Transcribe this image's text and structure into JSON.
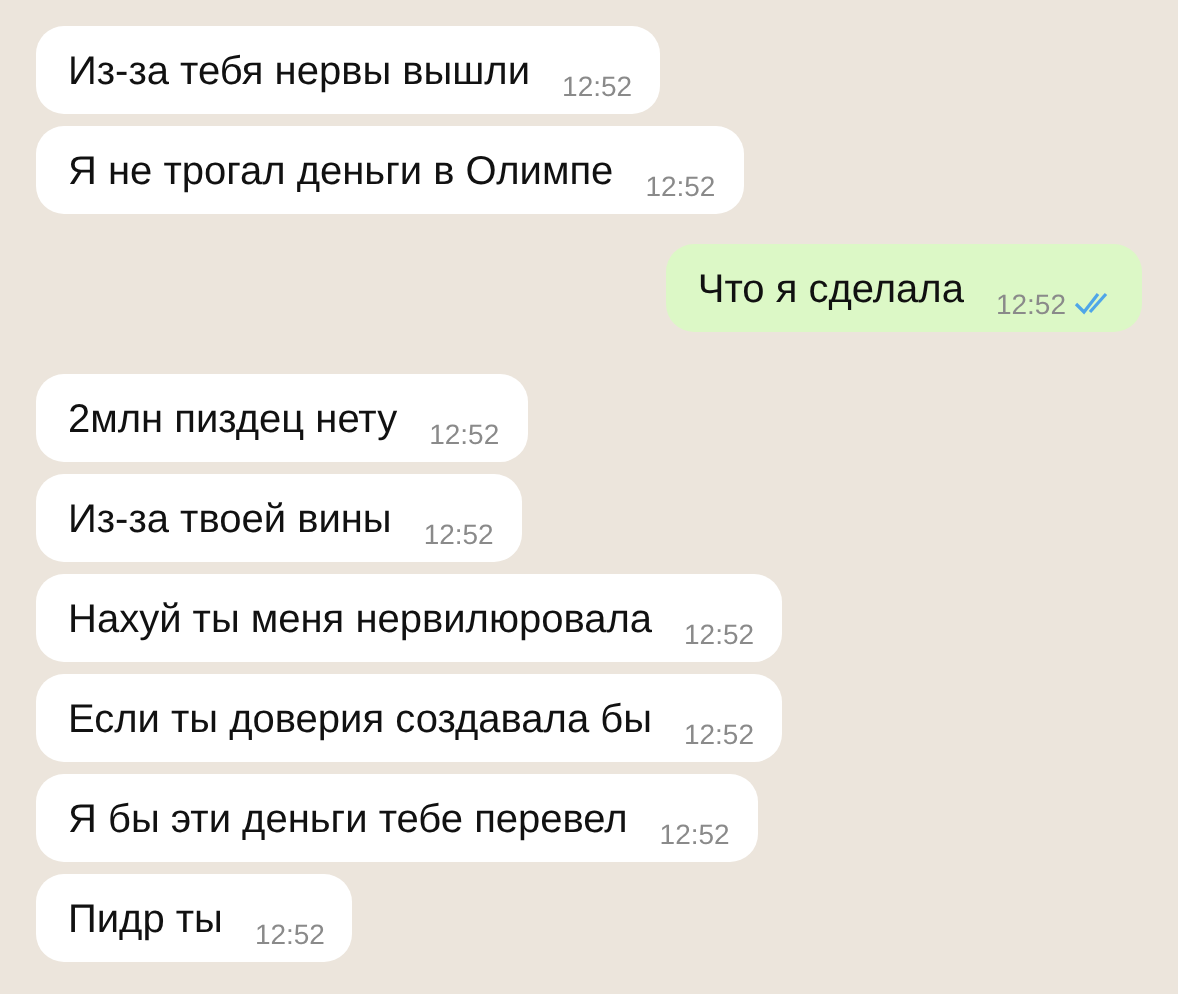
{
  "messages": [
    {
      "kind": "incoming",
      "text": "Из-за тебя нервы вышли",
      "time": "12:52"
    },
    {
      "kind": "incoming",
      "text": "Я не трогал деньги в Олимпе",
      "time": "12:52"
    },
    {
      "kind": "outgoing",
      "text": "Что я сделала",
      "time": "12:52",
      "read": true
    },
    {
      "kind": "incoming",
      "text": "2млн пиздец нету",
      "time": "12:52"
    },
    {
      "kind": "incoming",
      "text": "Из-за твоей вины",
      "time": "12:52"
    },
    {
      "kind": "incoming",
      "text": "Нахуй ты меня нервилюровала",
      "time": "12:52"
    },
    {
      "kind": "incoming",
      "text": "Если ты доверия создавала бы",
      "time": "12:52"
    },
    {
      "kind": "incoming",
      "text": "Я бы эти деньги тебе перевел",
      "time": "12:52"
    },
    {
      "kind": "incoming",
      "text": "Пидр ты",
      "time": "12:52"
    }
  ]
}
